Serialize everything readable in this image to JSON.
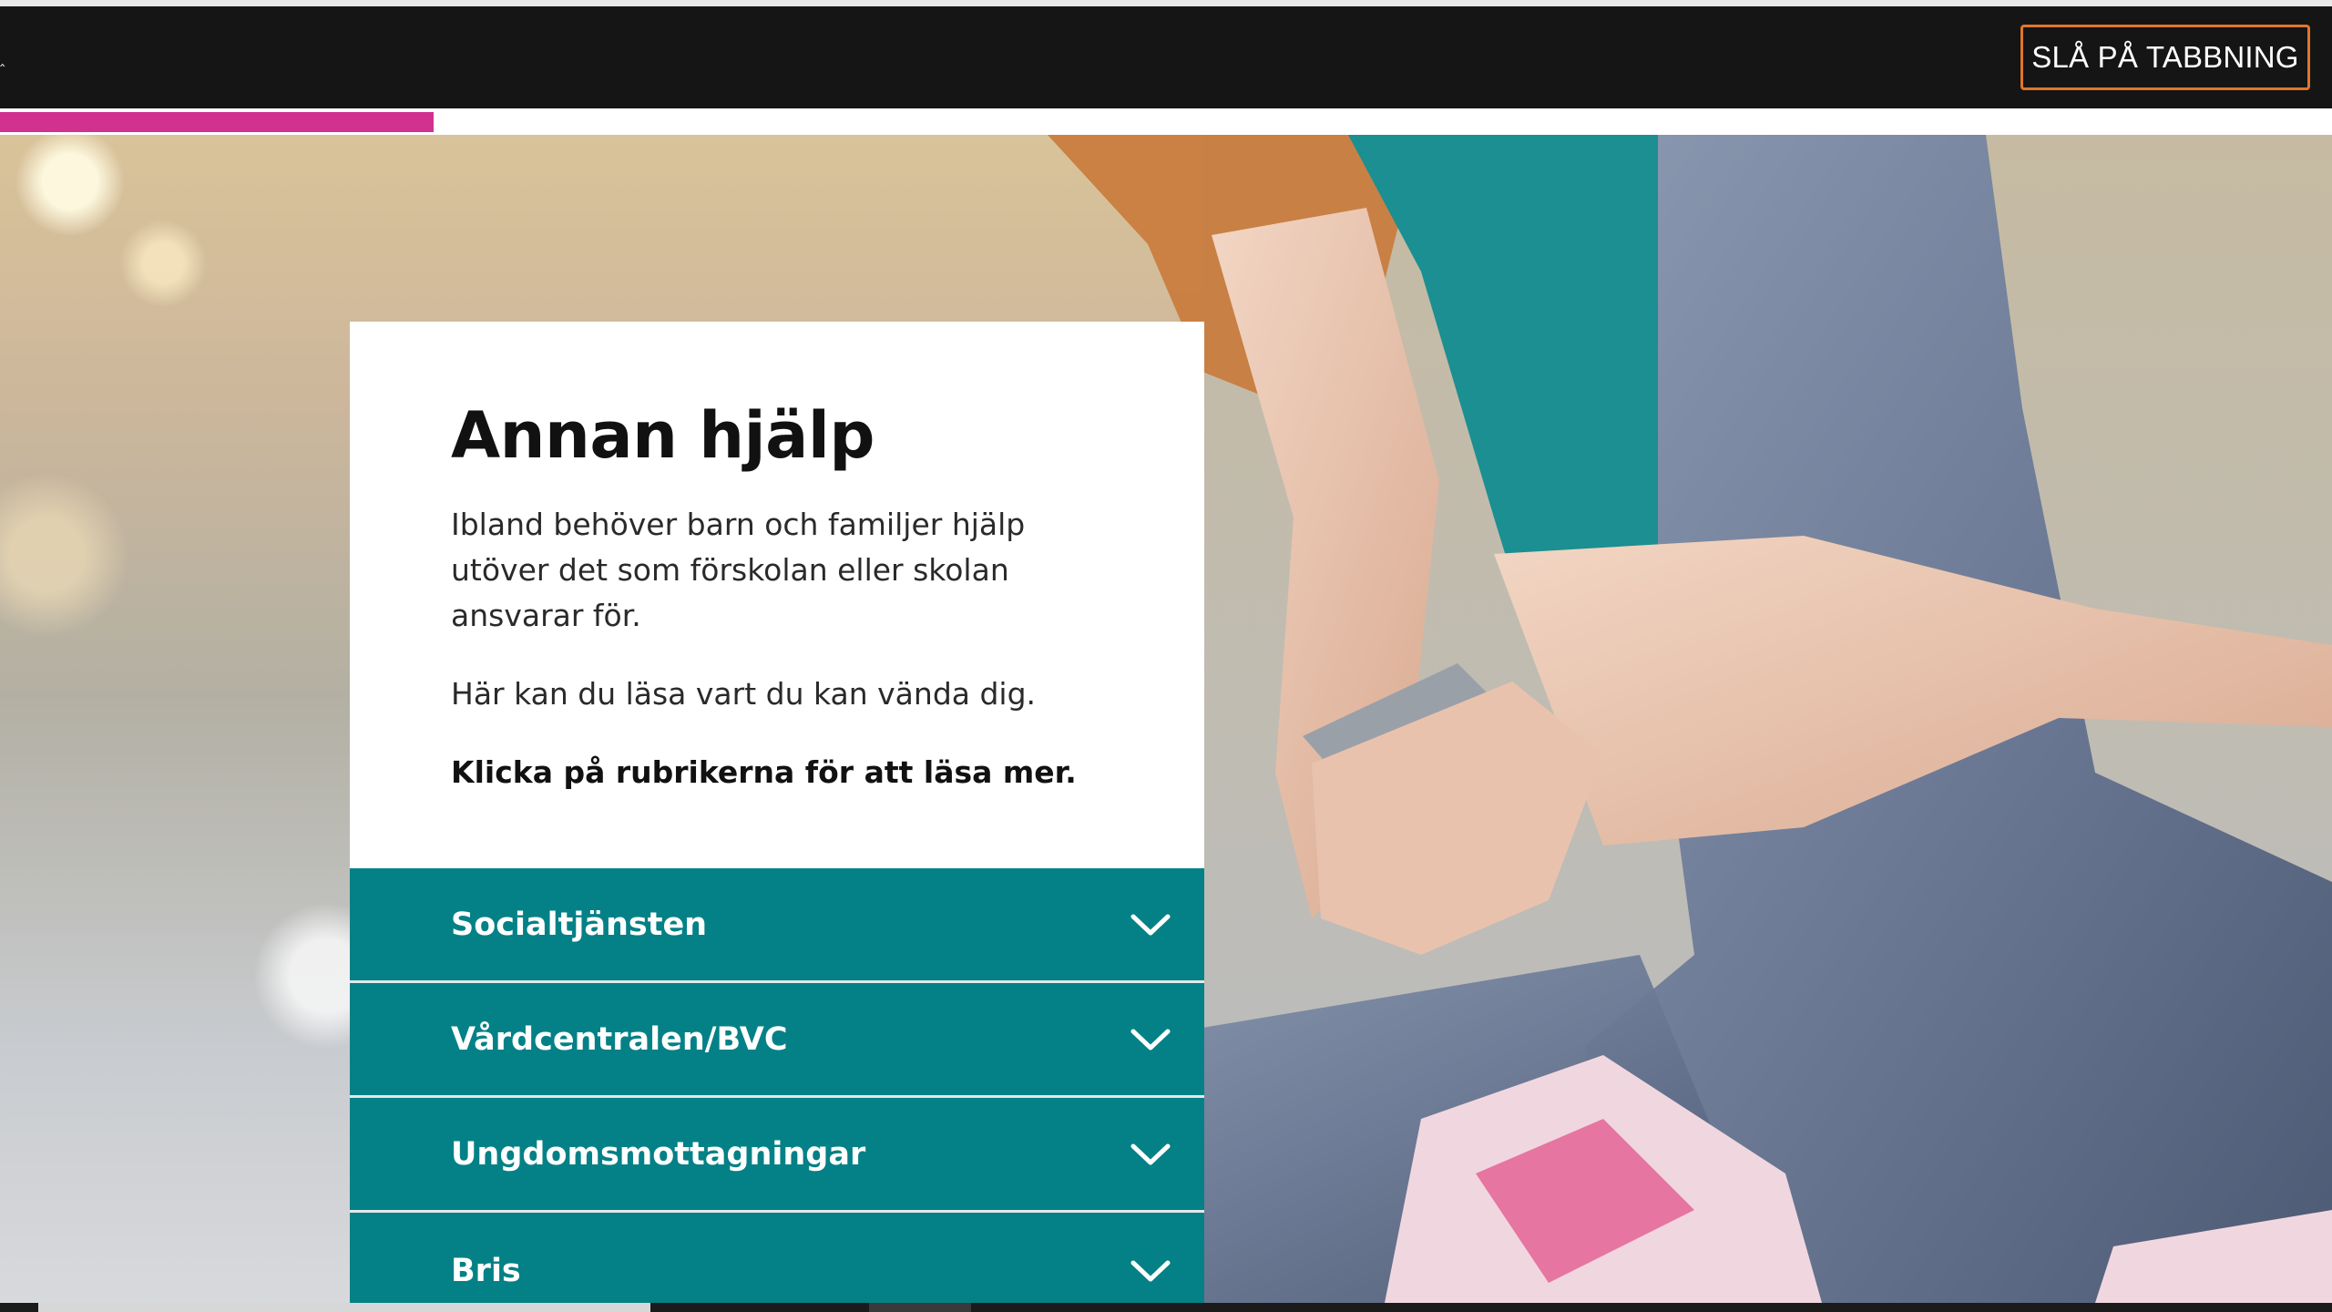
{
  "toolbar": {
    "tab_toggle_label": "SLÅ PÅ TABBNING",
    "back_caret": "‸"
  },
  "progress": {
    "value_fraction": 0.186,
    "color": "#d1318f"
  },
  "card": {
    "title": "Annan hjälp",
    "paragraph1": "Ibland behöver barn och familjer hjälp utöver det som förskolan eller skolan ansvarar för.",
    "paragraph2": "Här kan du läsa vart du kan vända dig.",
    "instruction": "Klicka på rubrikerna för att läsa mer."
  },
  "accordion": {
    "color": "#048186",
    "items": [
      {
        "label": "Socialtjänsten",
        "icon": "chevron-down-icon"
      },
      {
        "label": "Vårdcentralen/BVC",
        "icon": "chevron-down-icon"
      },
      {
        "label": "Ungdomsmottagningar",
        "icon": "chevron-down-icon"
      },
      {
        "label": "Bris",
        "icon": "chevron-down-icon"
      }
    ]
  },
  "colors": {
    "topbar": "#151515",
    "toggle_border": "#e0762c",
    "accent_pink": "#d1318f",
    "teal": "#048186"
  }
}
